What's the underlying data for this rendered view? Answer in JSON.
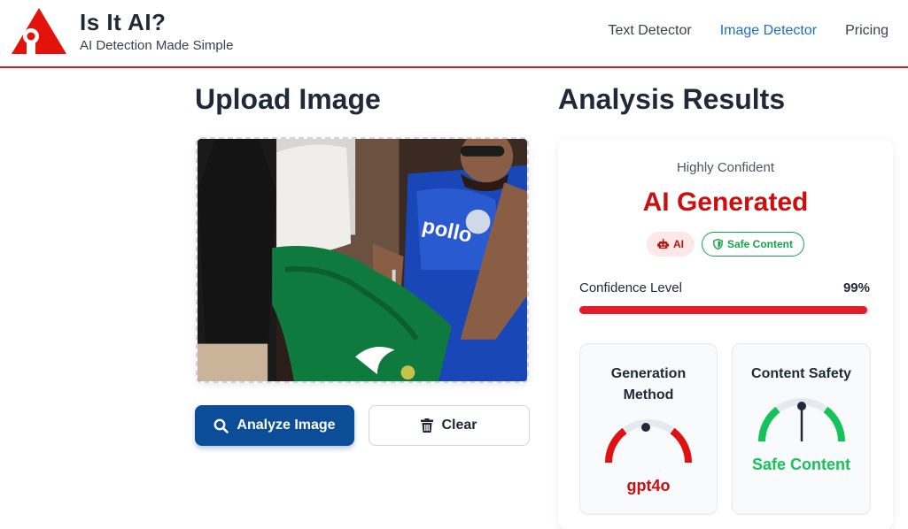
{
  "brand": {
    "title": "Is It AI?",
    "tagline": "AI Detection Made Simple",
    "logo_icon": "red-triangle-eye-logo",
    "accent_color": "#d71920"
  },
  "nav": {
    "items": [
      {
        "label": "Text Detector",
        "active": false
      },
      {
        "label": "Image Detector",
        "active": true
      },
      {
        "label": "Pricing",
        "active": false
      }
    ],
    "active_color": "#1d6fc2"
  },
  "upload": {
    "heading": "Upload Image",
    "image_alt": "Uploaded photo: two men signing a green Pakistan cricket jersey",
    "analyze_label": "Analyze Image",
    "analyze_icon": "search-icon",
    "clear_label": "Clear",
    "clear_icon": "trash-icon"
  },
  "results": {
    "heading": "Analysis Results",
    "confidence_text": "Highly Confident",
    "verdict": "AI Generated",
    "verdict_color": "#d00d0d",
    "badges": [
      {
        "label": "AI",
        "icon": "robot-icon"
      },
      {
        "label": "Safe Content",
        "icon": "shield-icon"
      }
    ],
    "confidence_label": "Confidence Level",
    "confidence_value": "99%",
    "confidence_fraction": 0.99,
    "generation": {
      "title": "Generation Method",
      "value": "gpt4o"
    },
    "safety": {
      "title": "Content Safety",
      "value": "Safe Content",
      "color": "#16c25a"
    }
  }
}
